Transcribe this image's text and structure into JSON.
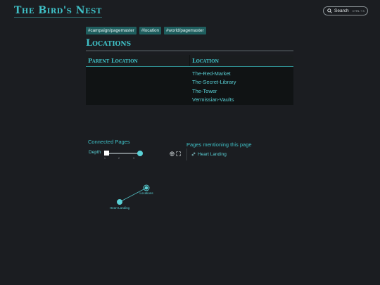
{
  "header": {
    "site_title": "The Bird's Nest",
    "search_label": "Search",
    "search_shortcut": "CTRL + K",
    "search_icon": "search-icon"
  },
  "tags": [
    "#campaign/pagemaster",
    "#location",
    "#world/pagemaster"
  ],
  "page": {
    "title": "Locations"
  },
  "table": {
    "headers": [
      "Parent Location",
      "Location"
    ],
    "parent_location": "",
    "locations": [
      "The-Red-Market",
      "The-Secret-Library",
      "The-Tower",
      "Vermissian-Vaults"
    ]
  },
  "graph": {
    "title": "Connected Pages",
    "depth_label": "Depth",
    "depth_ticks": [
      "1",
      "2",
      "3"
    ],
    "depth_value": 3,
    "icons": [
      "globe-icon",
      "fullscreen-icon"
    ],
    "nodes": [
      {
        "label": "Locations",
        "current": true
      },
      {
        "label": "Heart Landing",
        "current": false
      }
    ]
  },
  "backlinks": {
    "title": "Pages mentioning this page",
    "items": [
      {
        "label": "Heart Landing",
        "icon": "link-icon"
      }
    ]
  }
}
